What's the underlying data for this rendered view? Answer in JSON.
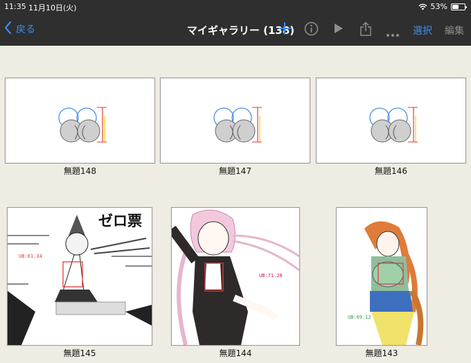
{
  "status": {
    "time": "11:35",
    "date": "11月10日(火)",
    "battery_percent": "53%",
    "battery_level": 0.53
  },
  "nav": {
    "back_label": "戻る",
    "title": "マイギャラリー (138)",
    "select_label": "選択",
    "edit_label": "編集",
    "icons": [
      "chevron-left-icon",
      "plus-icon",
      "info-icon",
      "play-icon",
      "share-icon",
      "more-icon"
    ]
  },
  "colors": {
    "bar_bg": "#2f2f2f",
    "accent": "#3a8ef0",
    "disabled": "#8e8e8e",
    "gallery_bg": "#efece3"
  },
  "gallery": {
    "items": [
      {
        "label": "無題148"
      },
      {
        "label": "無題147"
      },
      {
        "label": "無題146"
      },
      {
        "label": "無題145",
        "overlay_title": "ゼロ票",
        "measure_1": "UB:61.34"
      },
      {
        "label": "無題144",
        "measure_1": "UB:71.28"
      },
      {
        "label": "無題143",
        "measure_1": "UB:69.12"
      }
    ]
  }
}
